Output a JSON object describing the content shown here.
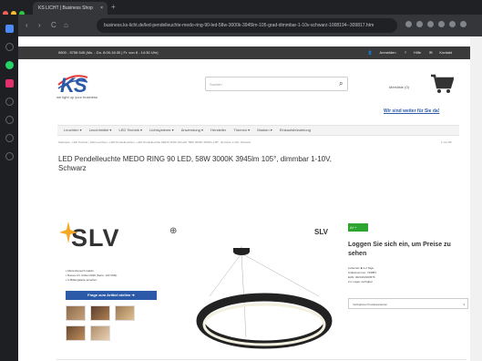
{
  "browser": {
    "tab_title": "KS LICHT | Business Shop",
    "tab_close": "×",
    "new_tab": "+",
    "back": "‹",
    "forward": "›",
    "reload": "C",
    "home": "⌂",
    "url": "business.ks-licht.de/led-pendelleuchte-medo-ring-90-led-58w-3000k-3945lm-105-grad-dimmbar-1-10v-schwarz-1008194--309817.htm"
  },
  "topbar": {
    "phone": "0800 - 5758 545 (Mo. - Do. 8:00-16:30 | Fr. von 8 - 14:30 Uhr)",
    "anmelden": "Anmelden",
    "hilfe": "Hilfe",
    "kontakt": "Kontakt"
  },
  "brand": {
    "logo_text": "KS",
    "slogan": "we light up your business"
  },
  "search": {
    "placeholder": "Suchen"
  },
  "header": {
    "merkliste": "Merkliste (0)",
    "wir_sind_weiter": "Wir sind weiter für Sie da!"
  },
  "nav": {
    "items": [
      "Leuchten ▾",
      "Leuchtmittel ▾",
      "LED Technik ▾",
      "Lichtsysteme ▾",
      "Anwendung ▾",
      "Hersteller",
      "Themen ▾",
      "Marken ▾",
      "Einkaufsbündelung"
    ]
  },
  "breadcrumb": {
    "text": "Startseite › LED Technik › LED Leuchten › LED Pendelleuchten › LED Pendelleuchte MEDO RING 90 LED, 58W 3000K 3945lm 105°, dimmbar 1-10V, Schwarz",
    "count": "1 von 89"
  },
  "product": {
    "title": "LED Pendelleuchte MEDO RING 90 LED, 58W 3000K 3945lm 105°, dimmbar 1-10V, Schwarz",
    "brand_logo": "SLV",
    "features": [
      "Aktionsbereich inaktiv",
      "Dieses Art. Artikel 2020 (Serie: 120 VDE)",
      "In Bildergalerie ansehen"
    ],
    "ask_button": "Frage zum Artikel stellen ➜",
    "energy_label": "A++",
    "login_text": "Loggen Sie sich ein, um Preise zu sehen",
    "lieferzeit": "Lieferzeit: ■ 1-2 Tage",
    "artikelnummer": "Artikelnummer: 729881",
    "ean": "EAN: 4024163194576",
    "versand": "2 in Lager verfügbar",
    "dropdown": "Verfügbare Produktvarianten"
  },
  "colors": {
    "accent": "#2d5aa8",
    "energy": "#2ea52f",
    "topbar": "#3a3a3a"
  }
}
